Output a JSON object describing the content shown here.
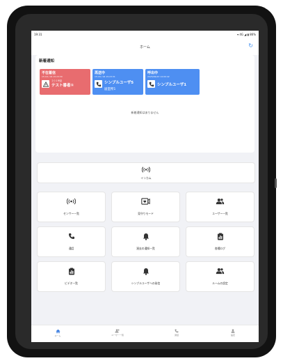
{
  "status_bar": {
    "time": "19:31",
    "right": "▾ 4G ◢ ▮ 86%"
  },
  "app_bar": {
    "title": "ホーム"
  },
  "new_notifications": {
    "title": "新着通知",
    "cards": [
      {
        "status": "不在着信",
        "timestamp": "15:18 / 04 15:23:30",
        "sub": "２０１号室",
        "name": "テスト番者①",
        "color": "#e86c6f"
      },
      {
        "status": "再送中",
        "timestamp": "15:18 / 04 15:23:31",
        "sub": "",
        "name": "シンプルユーザ5",
        "name2": "居室所1",
        "color": "#4e8ff2"
      },
      {
        "status": "呼出中",
        "timestamp": "2025/06/23 14:00:42",
        "sub": "",
        "name": "シンプルユーザ1",
        "color": "#4e8ff2"
      }
    ],
    "empty_message": "新着通知はありません"
  },
  "intercom": {
    "label": "インカム"
  },
  "menu": [
    {
      "label": "センサー一覧",
      "icon": "sensor-icon"
    },
    {
      "label": "見守りモード",
      "icon": "monitor-icon"
    },
    {
      "label": "ユーザー一覧",
      "icon": "users-icon"
    },
    {
      "label": "通話",
      "icon": "phone-icon"
    },
    {
      "label": "過去の通知一覧",
      "icon": "bell-icon"
    },
    {
      "label": "各種ログ",
      "icon": "log-icon"
    },
    {
      "label": "ビデオ一覧",
      "icon": "video-log-icon"
    },
    {
      "label": "シンプルユーザへの発信",
      "icon": "bell-icon"
    },
    {
      "label": "ルームの設定",
      "icon": "room-settings-icon"
    }
  ],
  "bottom_nav": [
    {
      "label": "ホーム",
      "icon": "home-icon",
      "color": "#3d7ee0"
    },
    {
      "label": "ユーザー一覧",
      "icon": "users-icon",
      "color": "#999999"
    },
    {
      "label": "通話",
      "icon": "phone-icon",
      "color": "#999999"
    },
    {
      "label": "設定",
      "icon": "person-icon",
      "color": "#999999"
    }
  ]
}
